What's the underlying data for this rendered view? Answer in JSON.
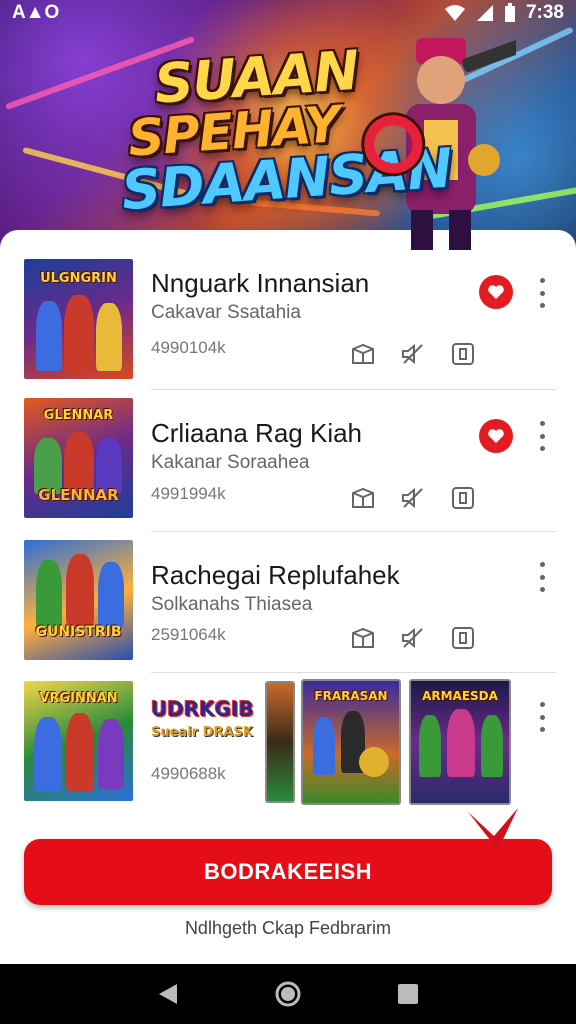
{
  "status_bar": {
    "left_text": "A▲O",
    "time": "7:38"
  },
  "hero": {
    "logo_line1": "SUAAN",
    "logo_line2": "SPEHAY",
    "logo_line3": "SDAANSAN"
  },
  "games": [
    {
      "title": "Nnguark Innansian",
      "subtitle": "Cakavar Ssatahia",
      "meta": "4990104k",
      "thumb_text": "ULGNGRIN",
      "favorited": true
    },
    {
      "title": "Crliaana Rag Kiah",
      "subtitle": "Kakanar Soraahea",
      "meta": "4991994k",
      "thumb_text": "GLENNAR",
      "favorited": true
    },
    {
      "title": "Rachegai Replufahek",
      "subtitle": "Solkanahs Thiaseа",
      "meta": "2591064k",
      "thumb_text": "GUNISTRIB",
      "favorited": false
    },
    {
      "title": "",
      "subtitle": "",
      "meta": "4990688k",
      "thumb_text": "VRGINNAN",
      "banner_line1": "UDRKGIB",
      "banner_line2": "Sueair DRASK",
      "mini_card_1": "FRARASAN",
      "mini_card_2": "ARMAESDA",
      "favorited": false
    }
  ],
  "cta": {
    "label": "BODRAKEEISH"
  },
  "footer": {
    "text": "Ndlhgeth Ckap Fedbrarim"
  },
  "colors": {
    "accent": "#e40d18",
    "text": "#1a1a1a",
    "muted": "#666666"
  }
}
